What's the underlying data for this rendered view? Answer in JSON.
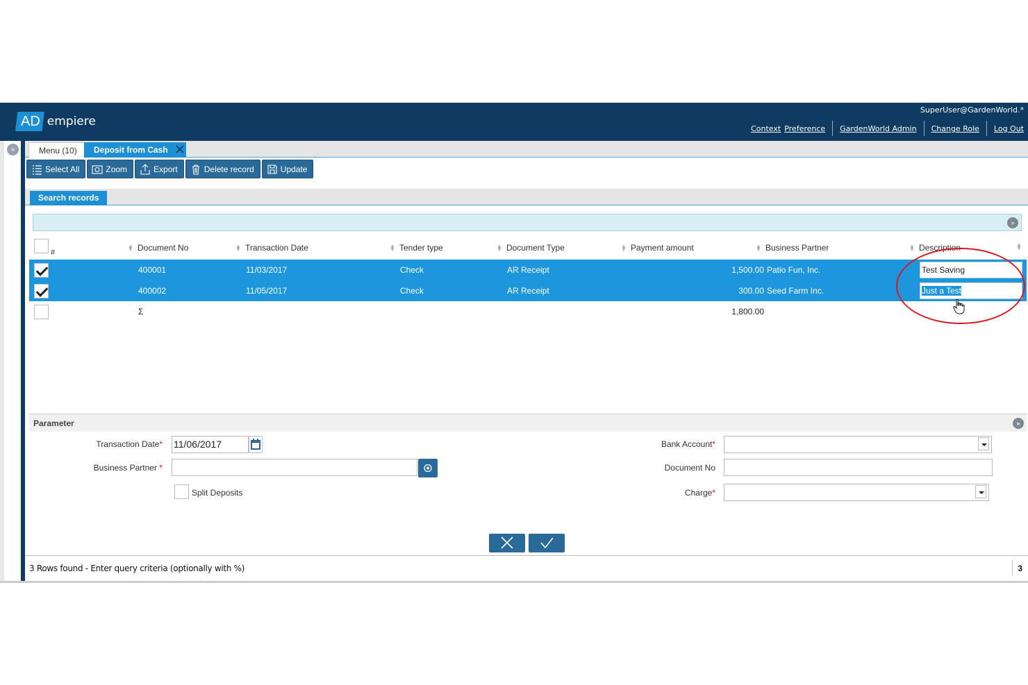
{
  "header": {
    "logo_ad": "AD",
    "logo_rest": "empiere",
    "user": "SuperUser@GardenWorld.*",
    "links": {
      "context": "Context",
      "preference": "Preference",
      "org": "GardenWorld Admin",
      "change_role": "Change Role",
      "logout": "Log Out"
    }
  },
  "tabs": {
    "menu": "Menu (10)",
    "active": "Deposit from Cash"
  },
  "toolbar": {
    "select_all": "Select All",
    "zoom": "Zoom",
    "export": "Export",
    "delete": "Delete record",
    "update": "Update"
  },
  "search": {
    "tab_label": "Search records"
  },
  "grid": {
    "columns": {
      "num": "#",
      "document_no": "Document No",
      "transaction_date": "Transaction Date",
      "tender_type": "Tender type",
      "document_type": "Document Type",
      "payment_amount": "Payment amount",
      "business_partner": "Business Partner",
      "description": "Description"
    },
    "rows": [
      {
        "document_no": "400001",
        "transaction_date": "11/03/2017",
        "tender_type": "Check",
        "document_type": "AR Receipt",
        "payment_amount": "1,500.00",
        "business_partner": "Patio Fun, Inc.",
        "description": "Test Saving",
        "checked": true
      },
      {
        "document_no": "400002",
        "transaction_date": "11/05/2017",
        "tender_type": "Check",
        "document_type": "AR Receipt",
        "payment_amount": "300.00",
        "business_partner": "Seed Farm Inc.",
        "description": "Just a Test",
        "checked": true
      }
    ],
    "totals": {
      "sigma": "Σ",
      "payment_amount": "1,800.00"
    }
  },
  "parameter": {
    "title": "Parameter",
    "transaction_date_label": "Transaction Date",
    "transaction_date_value": "11/06/2017",
    "business_partner_label": "Business Partner",
    "business_partner_value": "",
    "split_deposits_label": "Split Deposits",
    "bank_account_label": "Bank Account",
    "bank_account_value": "",
    "document_no_label": "Document No",
    "document_no_value": "",
    "charge_label": "Charge",
    "charge_value": "",
    "required_mark": "*"
  },
  "status": {
    "message": "3 Rows found - Enter query criteria (optionally with %)",
    "count": "3"
  },
  "colors": {
    "header_bg": "#0f3a62",
    "accent": "#1d8fd4",
    "button_bg": "#2a6a99",
    "selected_row": "#1d96dd",
    "annotation": "#d71920"
  }
}
